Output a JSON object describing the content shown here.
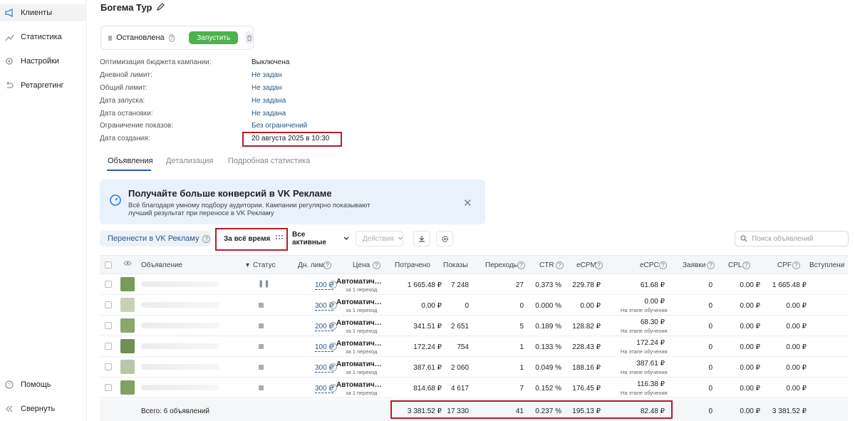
{
  "sidebar": {
    "items": [
      {
        "label": "Клиенты",
        "icon": "megaphone-icon",
        "active": true
      },
      {
        "label": "Статистика",
        "icon": "chart-line-icon",
        "active": false
      },
      {
        "label": "Настройки",
        "icon": "gear-icon",
        "active": false
      },
      {
        "label": "Ретаргетинг",
        "icon": "retarget-icon",
        "active": false
      }
    ],
    "help": {
      "label": "Помощь",
      "icon": "help-circle-icon"
    },
    "collapse": {
      "label": "Свернуть",
      "icon": "double-chevron-left-icon"
    }
  },
  "campaign": {
    "title": "Богема Тур",
    "status": "Остановлена",
    "start_button": "Запустить"
  },
  "info": [
    {
      "label": "Оптимизация бюджета кампании:",
      "value": "Выключена",
      "link": false
    },
    {
      "label": "Дневной лимит:",
      "value": "Не задан",
      "link": true
    },
    {
      "label": "Общий лимит:",
      "value": "Не задан",
      "link": true
    },
    {
      "label": "Дата запуска:",
      "value": "Не задана",
      "link": true
    },
    {
      "label": "Дата остановки:",
      "value": "Не задана",
      "link": true
    },
    {
      "label": "Ограничение показов:",
      "value": "Без ограничений",
      "link": true
    },
    {
      "label": "Дата создания:",
      "value": "20 августа 2025 в 10:30",
      "link": false
    }
  ],
  "tabs": [
    "Объявления",
    "Детализация",
    "Подробная статистика"
  ],
  "banner": {
    "title": "Получайте больше конверсий в VK Рекламе",
    "text": "Всё благодаря умному подбору аудитории. Кампании регулярно показывают лучший результат при переносе в VK Рекламу"
  },
  "toolbar": {
    "transfer": "Перенести в VK Рекламу",
    "period": "За всё время",
    "filter": "Все активные",
    "actions": "Действия",
    "search_placeholder": "Поиск объявлений"
  },
  "table": {
    "headers": {
      "ad": "Объявление",
      "status": "Статус",
      "limit": "Дн. лим.",
      "price": "Цена",
      "spent": "Потрачено",
      "shows": "Показы",
      "clicks": "Переходы",
      "ctr": "CTR",
      "ecpm": "eCPM",
      "ecpc": "eCPC",
      "leads": "Заявки",
      "cpl": "CPL",
      "cpf": "CPF",
      "joined": "Вступлени"
    },
    "price_main": "Автоматич…",
    "price_sub": "за 1 переход",
    "learning_note": "На этапе обучения",
    "rows": [
      {
        "limit": "100 ₽",
        "spent": "1 665.48 ₽",
        "shows": "7 248",
        "clicks": "27",
        "ctr": "0.373 %",
        "ecpm": "229.78 ₽",
        "ecpc": "61.68 ₽",
        "learning": false,
        "leads": "0",
        "cpl": "0.00 ₽",
        "cpf": "1 665.48 ₽",
        "paused": true
      },
      {
        "limit": "300 ₽",
        "spent": "0.00 ₽",
        "shows": "0",
        "clicks": "0",
        "ctr": "0.000 %",
        "ecpm": "0.00 ₽",
        "ecpc": "0.00 ₽",
        "learning": true,
        "leads": "0",
        "cpl": "0.00 ₽",
        "cpf": "0.00 ₽",
        "paused": false
      },
      {
        "limit": "200 ₽",
        "spent": "341.51 ₽",
        "shows": "2 651",
        "clicks": "5",
        "ctr": "0.189 %",
        "ecpm": "128.82 ₽",
        "ecpc": "68.30 ₽",
        "learning": true,
        "leads": "0",
        "cpl": "0.00 ₽",
        "cpf": "0.00 ₽",
        "paused": false
      },
      {
        "limit": "100 ₽",
        "spent": "172.24 ₽",
        "shows": "754",
        "clicks": "1",
        "ctr": "0.133 %",
        "ecpm": "228.43 ₽",
        "ecpc": "172.24 ₽",
        "learning": true,
        "leads": "0",
        "cpl": "0.00 ₽",
        "cpf": "0.00 ₽",
        "paused": false
      },
      {
        "limit": "300 ₽",
        "spent": "387.61 ₽",
        "shows": "2 060",
        "clicks": "1",
        "ctr": "0.049 %",
        "ecpm": "188.16 ₽",
        "ecpc": "387.61 ₽",
        "learning": true,
        "leads": "0",
        "cpl": "0.00 ₽",
        "cpf": "0.00 ₽",
        "paused": false
      },
      {
        "limit": "300 ₽",
        "spent": "814.68 ₽",
        "shows": "4 617",
        "clicks": "7",
        "ctr": "0.152 %",
        "ecpm": "176.45 ₽",
        "ecpc": "116.38 ₽",
        "learning": true,
        "leads": "0",
        "cpl": "0.00 ₽",
        "cpf": "0.00 ₽",
        "paused": false
      }
    ],
    "total": {
      "label": "Всего: 6 объявлений",
      "spent": "3 381.52 ₽",
      "shows": "17 330",
      "clicks": "41",
      "ctr": "0.237 %",
      "ecpm": "195.13 ₽",
      "ecpc": "82.48 ₽",
      "leads": "0",
      "cpl": "0.00 ₽",
      "cpf": "3 381.52 ₽"
    }
  },
  "colors": {
    "accent": "#2a5885",
    "green": "#4bb34b",
    "highlight": "#b71c2d"
  }
}
